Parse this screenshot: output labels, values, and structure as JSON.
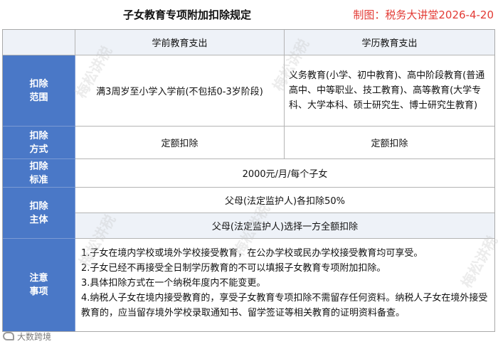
{
  "title": "子女教育专项附加扣除规定",
  "maker": "制图：税务大讲堂2026-4-20",
  "columns": [
    "学前教育支出",
    "学历教育支出"
  ],
  "rows": {
    "scope": {
      "label": "扣除范围",
      "preschool": "满3周岁至小学入学前(不包括0-3岁阶段)",
      "academic": "义务教育(小学、初中教育)、高中阶段教育(普通高中、中等职业、技工教育)、高等教育(大学专科、大学本科、硕士研究生、博士研究生教育)"
    },
    "method": {
      "label": "扣除方式",
      "preschool": "定额扣除",
      "academic": "定额扣除"
    },
    "standard": {
      "label": "扣除标准",
      "value": "2000元/月/每个子女"
    },
    "subject": {
      "label": "扣除主体",
      "option1": "父母(法定监护人)各扣除50%",
      "option2": "父母(法定监护人)选择一方全额扣除"
    },
    "notes": {
      "label": "注意事项",
      "items": [
        "1.子女在境内学校或境外学校接受教育，在公办学校或民办学校接受教育均可享受。",
        "2.子女已经不再接受全日制学历教育的不可以填报子女教育专项附加扣除。",
        "3.具体扣除方式在一个纳税年度内不能变更。",
        "4.纳税人子女在境内接受教育的，享受子女教育专项扣除不需留存任何资料。纳税人子女在境外接受教育的，应当留存境外学校录取通知书、留学签证等相关教育的证明资料备查。"
      ]
    }
  },
  "watermark": "梅松讲税",
  "footer_logo": "大数跨境",
  "colors": {
    "label_bg": "#4a78c7",
    "maker": "#e33b35",
    "light_row": "#eef2f8"
  }
}
